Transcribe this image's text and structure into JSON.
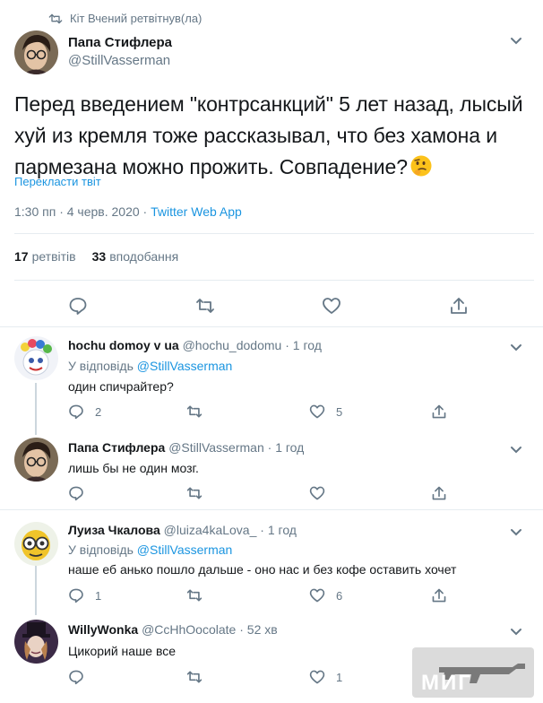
{
  "colors": {
    "accent": "#1b95e0",
    "muted": "#657786",
    "border": "#e6ecf0"
  },
  "retweet_header": {
    "icon": "retweet-icon",
    "text": "Кіт Вчений ретвітнув(ла)"
  },
  "main_tweet": {
    "author_name": "Папа Стифлера",
    "handle": "@StillVasserman",
    "text": "Перед введением \"контрсанкций\" 5 лет назад, лысый хуй из кремля тоже рассказывал, что без хамона и пармезана можно прожить.  Совпадение?",
    "emoji": "thinking-face-icon",
    "translate_label": "Перекласти твіт",
    "timestamp": "1:30 пп · 4 черв. 2020",
    "via": "Twitter Web App",
    "retweets_count": "17",
    "retweets_label": "ретвітів",
    "likes_count": "33",
    "likes_label": "вподобання"
  },
  "replies": [
    {
      "name": "hochu domoy v ua",
      "handle": "@hochu_dodomu",
      "time": "1 год",
      "reply_to_prefix": "У відповідь",
      "reply_to_handle": "@StillVasserman",
      "text": "один спичрайтер?",
      "reply_count": "2",
      "retweet_count": "",
      "like_count": "5"
    },
    {
      "name": "Папа Стифлера",
      "handle": "@StillVasserman",
      "time": "1 год",
      "text": "лишь бы не один мозг.",
      "reply_count": "",
      "retweet_count": "",
      "like_count": ""
    },
    {
      "name": "Луиза Чкалова",
      "handle": "@luiza4kaLova_",
      "time": "1 год",
      "reply_to_prefix": "У відповідь",
      "reply_to_handle": "@StillVasserman",
      "text": "наше еб анько пошло дальше - оно нас и без кофе оставить хочет",
      "reply_count": "1",
      "retweet_count": "",
      "like_count": "6"
    },
    {
      "name": "WillyWonka",
      "handle": "@CcHhOocolate",
      "time": "52 хв",
      "text": "Цикорий наше все",
      "reply_count": "",
      "retweet_count": "",
      "like_count": "1"
    }
  ],
  "watermark": {
    "text": "МИГ"
  }
}
